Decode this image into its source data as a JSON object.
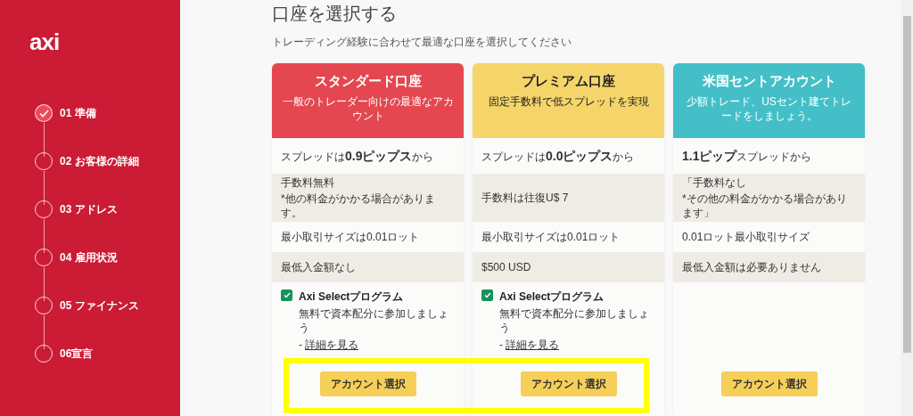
{
  "logo": "axi",
  "steps": [
    {
      "label": "01 準備",
      "done": true
    },
    {
      "label": "02 お客様の詳細",
      "done": false
    },
    {
      "label": "03 アドレス",
      "done": false
    },
    {
      "label": "04 雇用状況",
      "done": false
    },
    {
      "label": "05 ファイナンス",
      "done": false
    },
    {
      "label": "06宣言",
      "done": false
    }
  ],
  "title": "口座を選択する",
  "subtitle": "トレーディング経験に合わせて最適な口座を選択してください",
  "cards": [
    {
      "color": "#e4474f",
      "dark_text": false,
      "name": "スタンダード口座",
      "tagline": "一般のトレーダー向けの最適なアカウント",
      "spread": "スプレッドは**0.9ピップス**から",
      "fee": "手数料無料",
      "fee_note": "*他の料金がかかる場合があります。",
      "min_size": "最小取引サイズは0.01ロット",
      "deposit": "最低入金額なし",
      "program": {
        "checked": true,
        "title": "Axi Selectプログラム",
        "text": "無料で資本配分に参加しましょう",
        "prefix": "-",
        "link": "詳細を見る"
      },
      "button": "アカウント選択"
    },
    {
      "color": "#f5d56a",
      "dark_text": true,
      "name": "プレミアム口座",
      "tagline": "固定手数料で低スプレッドを実現",
      "spread": "スプレッドは**0.0ピップス**から",
      "fee": "手数料は往復U$ 7",
      "min_size": "最小取引サイズは0.01ロット",
      "deposit": "$500 USD",
      "program": {
        "checked": true,
        "title": "Axi Selectプログラム",
        "text": "無料で資本配分に参加しましょう",
        "prefix": "-",
        "link": "詳細を見る"
      },
      "button": "アカウント選択"
    },
    {
      "color": "#44bfc7",
      "dark_text": false,
      "name": "米国セントアカウント",
      "tagline": "少額トレード、USセント建てトレードをしましょう。",
      "spread": "**1.1ピップ**スプレッドから",
      "fee": "「手数料なし",
      "fee_note": "*その他の料金がかかる場合があります」",
      "min_size": "0.01ロット最小取引サイズ",
      "deposit": "最低入金額は必要ありません",
      "button": "アカウント選択"
    }
  ],
  "annotation": {
    "kind": "highlight"
  }
}
